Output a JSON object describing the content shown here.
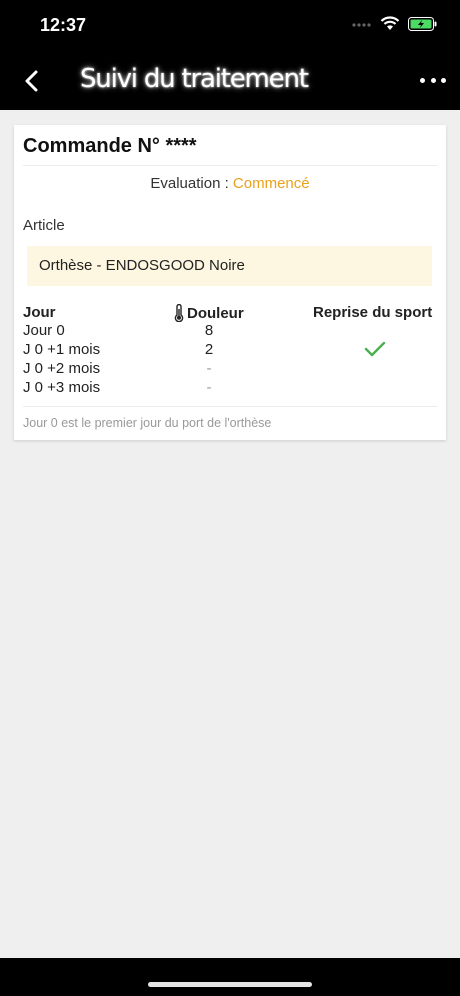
{
  "status": {
    "time": "12:37"
  },
  "nav": {
    "title": "Suivi du traitement",
    "back_icon": "chevron-left-icon",
    "more_icon": "more-horizontal-icon"
  },
  "order": {
    "title": "Commande N° ****",
    "evaluation_label": "Evaluation : ",
    "evaluation_status": "Commencé",
    "evaluation_color": "#e9a21b"
  },
  "article": {
    "label": "Article",
    "name": "Orthèse - ENDOSGOOD Noire"
  },
  "table": {
    "headers": {
      "day": "Jour",
      "pain": "Douleur",
      "sport": "Reprise du sport"
    },
    "rows": [
      {
        "day": "Jour 0",
        "pain": "8"
      },
      {
        "day": "J 0 +1 mois",
        "pain": "2",
        "sport": "check"
      },
      {
        "day": "J 0 +2 mois",
        "pain": "-"
      },
      {
        "day": "J 0 +3 mois",
        "pain": "-"
      }
    ],
    "check_color": "#4caf50"
  },
  "footnote": "Jour 0 est le premier jour du port de l'orthèse"
}
